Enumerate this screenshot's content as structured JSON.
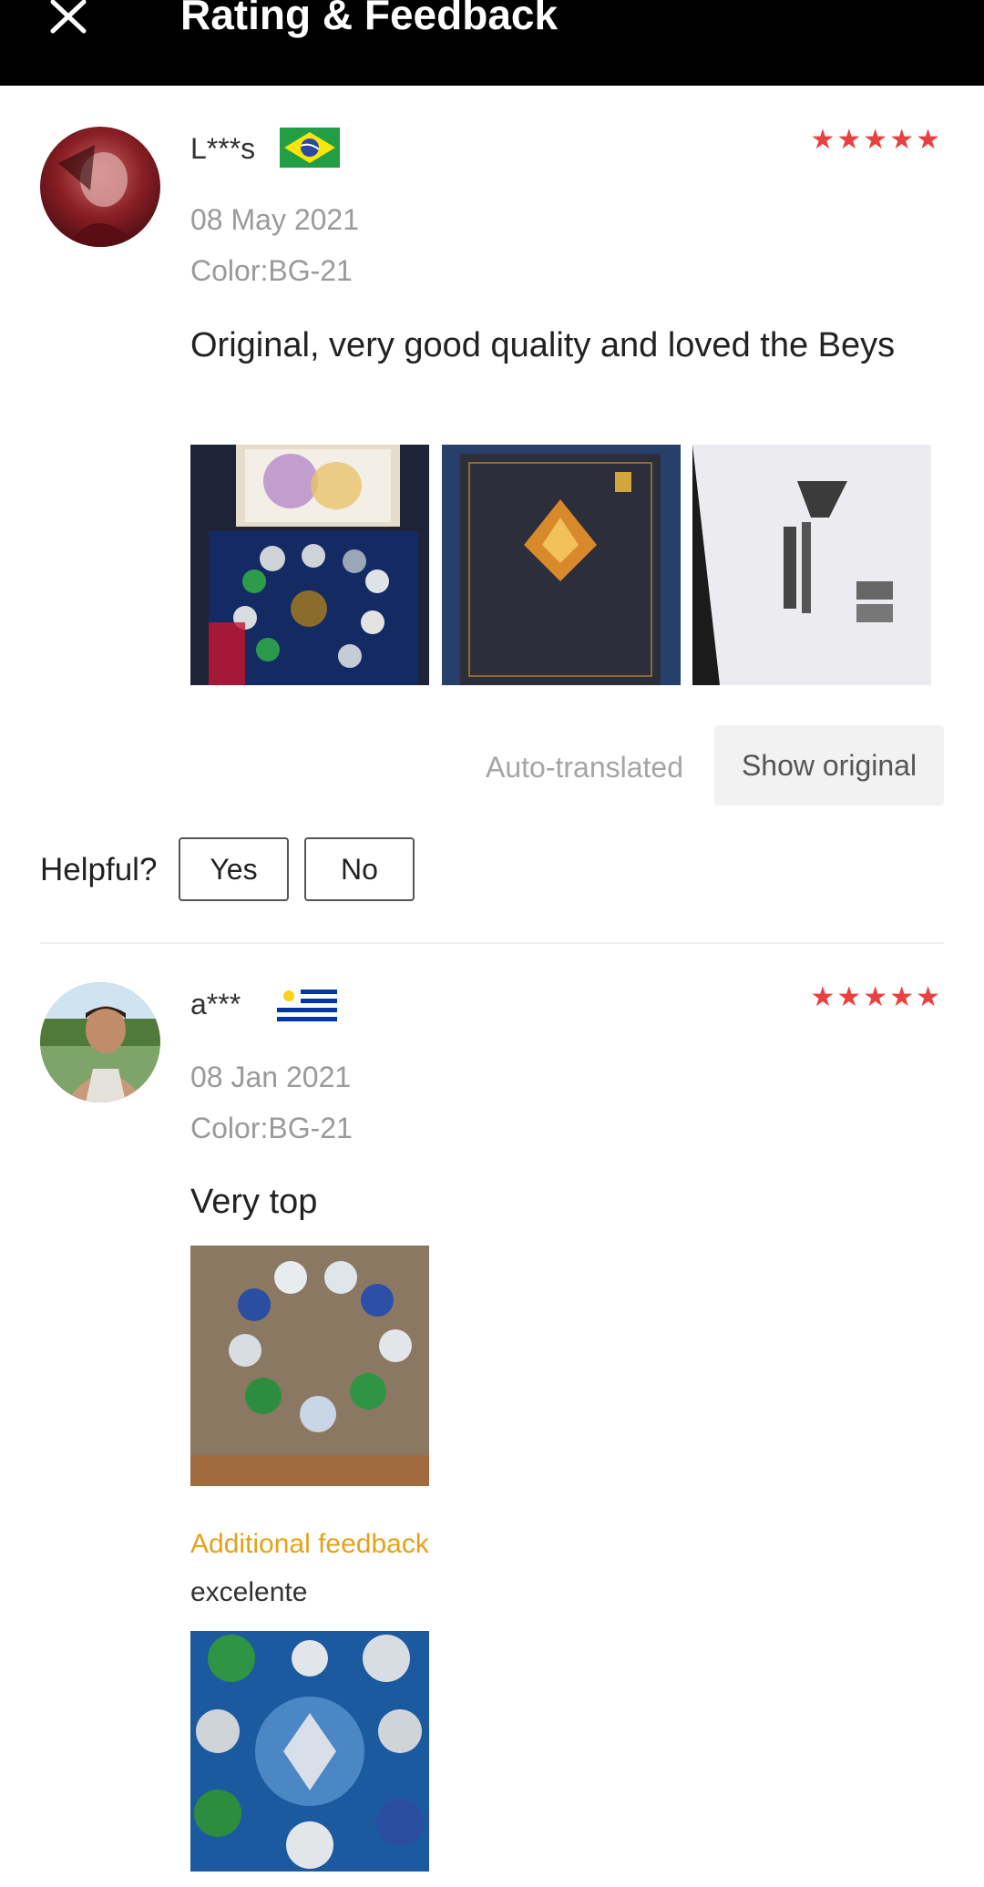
{
  "header": {
    "title": "Rating & Feedback",
    "close_icon": "close-icon"
  },
  "colors": {
    "star": "#e94040",
    "additional_feedback": "#e3a21a"
  },
  "reviews": [
    {
      "user": "L***s",
      "country_flag": "brazil-flag",
      "rating": 5,
      "stars_text": "★★★★★",
      "date": "08 May 2021",
      "color": "Color:BG-21",
      "comment": "Original, very good quality and loved the Beys",
      "photos": [
        "beyblade-set-photo",
        "box-photo",
        "box-label-photo"
      ],
      "auto_translated": "Auto-translated",
      "show_original": "Show original"
    },
    {
      "user": "a***",
      "country_flag": "uruguay-flag",
      "rating": 5,
      "stars_text": "★★★★★",
      "date": "08 Jan 2021",
      "color": "Color:BG-21",
      "comment": "Very top",
      "photos": [
        "beyblades-circle-photo"
      ],
      "additional_feedback_label": "Additional feedback",
      "additional_feedback_text": "excelente",
      "additional_photos": [
        "beyblades-blue-photo"
      ]
    }
  ],
  "helpful": {
    "label": "Helpful?",
    "yes": "Yes",
    "no": "No"
  }
}
